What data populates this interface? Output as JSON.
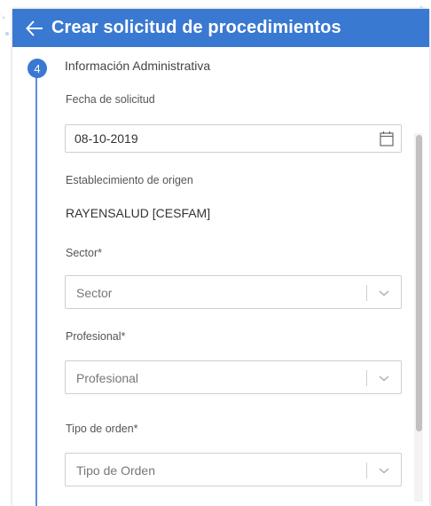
{
  "header": {
    "title": "Crear solicitud de procedimientos"
  },
  "step": {
    "number": "4",
    "title": "Información Administrativa"
  },
  "form": {
    "fecha": {
      "label": "Fecha de solicitud",
      "value": "08-10-2019"
    },
    "establecimiento": {
      "label": "Establecimiento de origen",
      "value": "RAYENSALUD [CESFAM]"
    },
    "sector": {
      "label": "Sector*",
      "placeholder": "Sector"
    },
    "profesional": {
      "label": "Profesional*",
      "placeholder": "Profesional"
    },
    "tipo_orden": {
      "label": "Tipo de orden*",
      "placeholder": "Tipo de Orden"
    }
  },
  "icons": {
    "back": "arrow-left-icon",
    "calendar": "calendar-icon",
    "chevron": "chevron-down-icon"
  },
  "colors": {
    "header_bg": "#3a79d2",
    "step_accent": "#3a79d2",
    "step_line": "#5b8fd8"
  }
}
